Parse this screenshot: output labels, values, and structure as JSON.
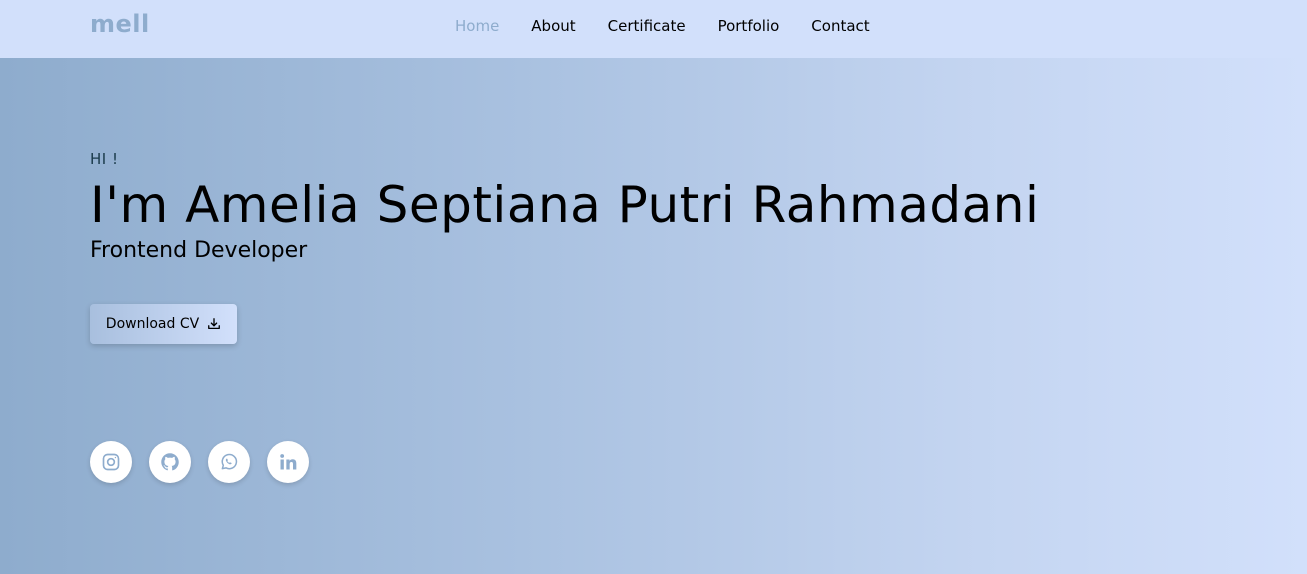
{
  "nav": {
    "logo": "mell",
    "links": [
      {
        "label": "Home",
        "active": true
      },
      {
        "label": "About",
        "active": false
      },
      {
        "label": "Certificate",
        "active": false
      },
      {
        "label": "Portfolio",
        "active": false
      },
      {
        "label": "Contact",
        "active": false
      }
    ]
  },
  "hero": {
    "greeting": "HI !",
    "name": "I'm Amelia Septiana Putri Rahmadani",
    "role": "Frontend Developer",
    "cv_button": {
      "label": "Download CV",
      "icon": "download-icon"
    }
  },
  "socials": [
    {
      "icon": "instagram-icon"
    },
    {
      "icon": "github-icon"
    },
    {
      "icon": "whatsapp-icon"
    },
    {
      "icon": "linkedin-icon"
    }
  ],
  "colors": {
    "accent": "#8eaccd",
    "nav_bg": "#d2e0fb",
    "icon": "#8eaccd"
  }
}
